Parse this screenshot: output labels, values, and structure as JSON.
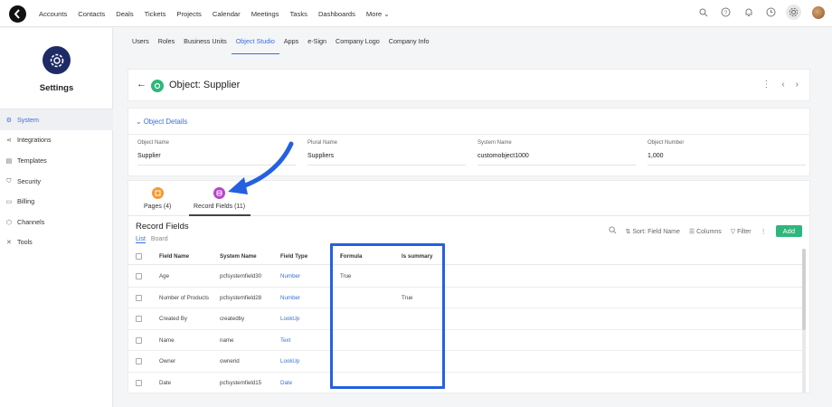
{
  "nav": {
    "items": [
      "Accounts",
      "Contacts",
      "Deals",
      "Tickets",
      "Projects",
      "Calendar",
      "Meetings",
      "Tasks",
      "Dashboards",
      "More"
    ]
  },
  "settings": {
    "title": "Settings"
  },
  "sidebar": {
    "items": [
      {
        "label": "System",
        "icon": "gear-icon",
        "active": true
      },
      {
        "label": "Integrations",
        "icon": "share-icon"
      },
      {
        "label": "Templates",
        "icon": "template-icon"
      },
      {
        "label": "Security",
        "icon": "shield-icon"
      },
      {
        "label": "Billing",
        "icon": "card-icon"
      },
      {
        "label": "Channels",
        "icon": "channels-icon"
      },
      {
        "label": "Tools",
        "icon": "tools-icon"
      }
    ]
  },
  "tabs": [
    {
      "label": "Users"
    },
    {
      "label": "Roles"
    },
    {
      "label": "Business Units"
    },
    {
      "label": "Object Studio",
      "active": true
    },
    {
      "label": "Apps"
    },
    {
      "label": "e-Sign"
    },
    {
      "label": "Company Logo"
    },
    {
      "label": "Company Info"
    }
  ],
  "object": {
    "title": "Object: Supplier"
  },
  "details": {
    "section_title": "Object Details",
    "fields": [
      {
        "label": "Object Name",
        "value": "Supplier"
      },
      {
        "label": "Plural Name",
        "value": "Suppliers"
      },
      {
        "label": "System Name",
        "value": "customobject1000"
      },
      {
        "label": "Object Number",
        "value": "1,000"
      }
    ]
  },
  "record_tabs": {
    "pages": "Pages (4)",
    "fields": "Record Fields (11)"
  },
  "records": {
    "title": "Record Fields",
    "views": {
      "list": "List",
      "board": "Board"
    },
    "toolbar": {
      "sort": "Sort: Field Name",
      "columns": "Columns",
      "filter": "Filter",
      "add": "Add"
    },
    "columns": {
      "field_name": "Field Name",
      "system_name": "System Name",
      "field_type": "Field Type",
      "formula": "Formula",
      "is_summary": "Is summary"
    },
    "rows": [
      {
        "field_name": "Age",
        "system_name": "pcfsystemfield30",
        "field_type": "Number",
        "formula": "True",
        "is_summary": ""
      },
      {
        "field_name": "Number of Products",
        "system_name": "pcfsystemfield28",
        "field_type": "Number",
        "formula": "",
        "is_summary": "True"
      },
      {
        "field_name": "Created By",
        "system_name": "createdby",
        "field_type": "LookUp",
        "formula": "",
        "is_summary": ""
      },
      {
        "field_name": "Name",
        "system_name": "name",
        "field_type": "Text",
        "formula": "",
        "is_summary": ""
      },
      {
        "field_name": "Owner",
        "system_name": "ownerid",
        "field_type": "LookUp",
        "formula": "",
        "is_summary": ""
      },
      {
        "field_name": "Date",
        "system_name": "pcfsystemfield15",
        "field_type": "Date",
        "formula": "",
        "is_summary": ""
      }
    ]
  },
  "colors": {
    "accent": "#3b6fd8",
    "green": "#2fb67c",
    "highlight": "#2460e0",
    "navy": "#1f2b66"
  }
}
